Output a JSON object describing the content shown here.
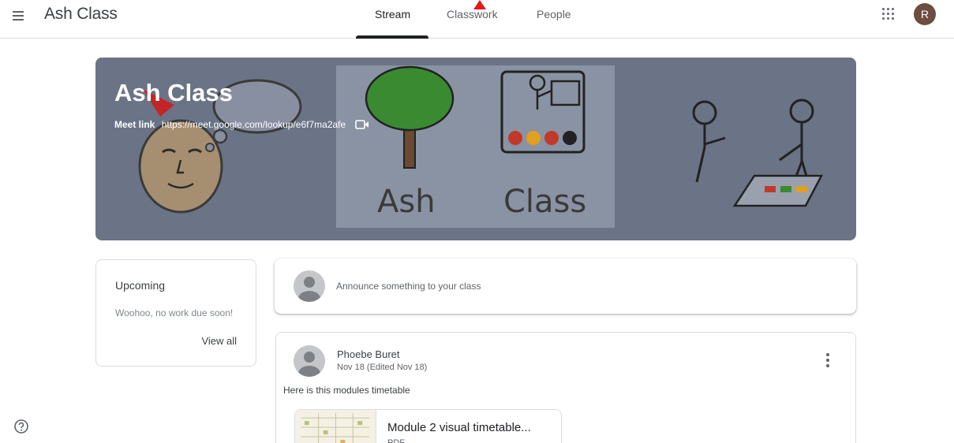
{
  "header": {
    "app_title": "Ash Class",
    "tabs": [
      {
        "label": "Stream",
        "active": true
      },
      {
        "label": "Classwork",
        "active": false
      },
      {
        "label": "People",
        "active": false
      }
    ],
    "user_initial": "R"
  },
  "banner": {
    "class_name": "Ash Class",
    "meet_label": "Meet link",
    "meet_url": "https://meet.google.com/lookup/e6f7ma2afe",
    "art_words": [
      "Ash",
      "Class"
    ]
  },
  "upcoming": {
    "title": "Upcoming",
    "empty_text": "Woohoo, no work due soon!",
    "view_all": "View all"
  },
  "announce": {
    "placeholder": "Announce something to your class"
  },
  "post": {
    "author": "Phoebe Buret",
    "date": "Nov 18 (Edited Nov 18)",
    "body": "Here is this modules timetable",
    "attachment": {
      "title": "Module 2 visual timetable...",
      "type": "PDF"
    }
  },
  "icons": {
    "menu": "menu-icon",
    "apps": "apps-grid-icon",
    "video": "video-camera-icon",
    "more": "more-vert-icon",
    "help": "help-icon"
  },
  "colors": {
    "banner": "#6a7486",
    "avatar": "#6d4c41",
    "annotation": "#e01b1b"
  }
}
